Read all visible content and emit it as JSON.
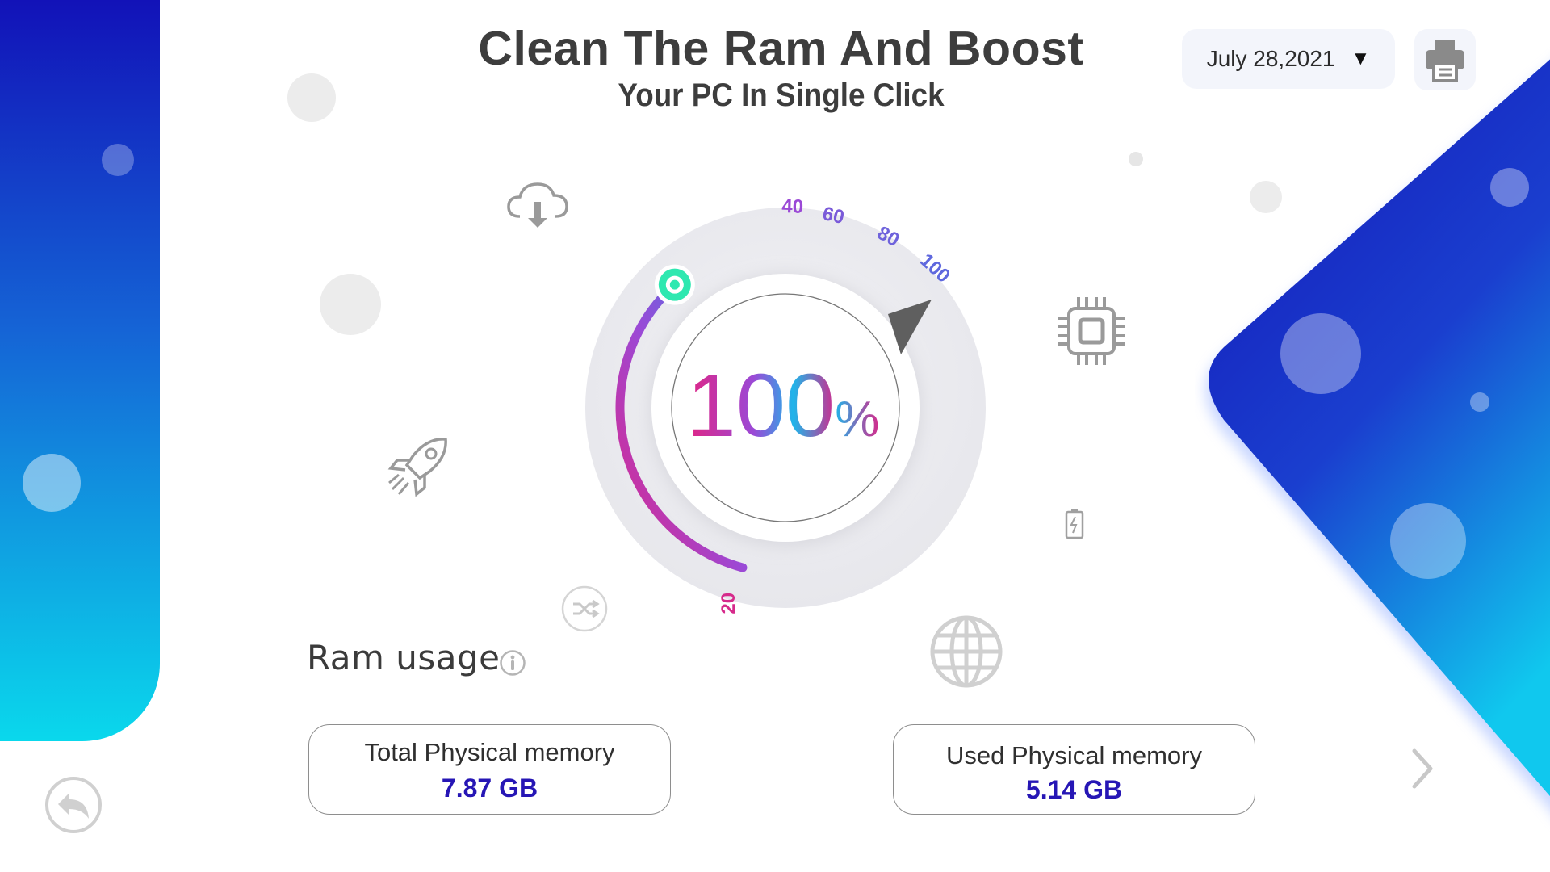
{
  "header": {
    "title": "Clean The Ram And Boost",
    "subtitle": "Your PC In Single Click"
  },
  "date_select": {
    "value": "July 28,2021",
    "caret": "▼"
  },
  "toolbar": {
    "print_icon": "printer-icon"
  },
  "gauge": {
    "percent_value": "100",
    "percent_unit": "%",
    "level": 1.0,
    "ticks": [
      "20",
      "40",
      "60",
      "80",
      "100"
    ],
    "colors": {
      "start": "#e02585",
      "mid": "#9b49d6",
      "end": "#1fb5ea",
      "knob": "#2ee8b0"
    }
  },
  "decor_icons": [
    "cloud-download-icon",
    "rocket-icon",
    "shuffle-icon",
    "cpu-chip-icon",
    "battery-icon",
    "globe-icon"
  ],
  "ram_usage": {
    "label": "Ram usage",
    "info_icon": "info-icon"
  },
  "memory": {
    "total": {
      "label": "Total Physical memory",
      "value": "7.87 GB"
    },
    "used": {
      "label": "Used Physical memory",
      "value": "5.14 GB"
    }
  },
  "nav": {
    "next_icon": "chevron-right-icon",
    "back_icon": "back-arrow-icon"
  },
  "theme": {
    "primary": "#1212b8",
    "accent": "#0ad8ec",
    "value_color": "#2616b5"
  }
}
